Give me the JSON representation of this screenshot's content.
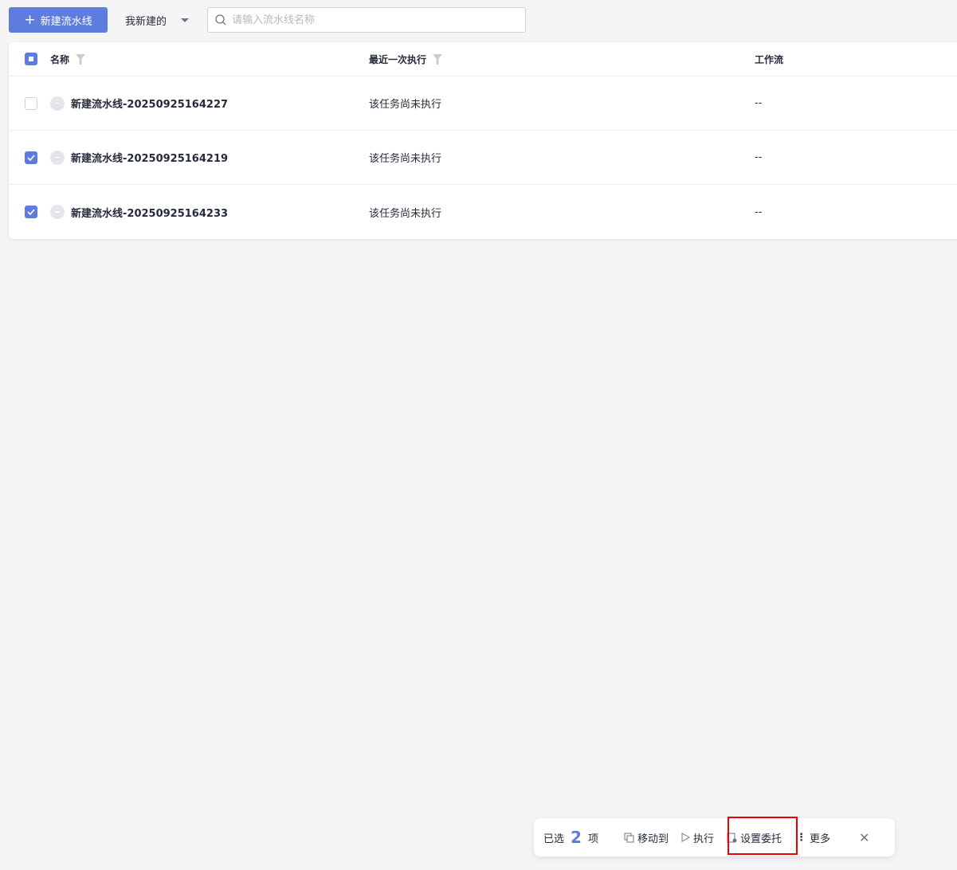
{
  "toolbar": {
    "new_label": "新建流水线",
    "filter_label": "我新建的",
    "search_placeholder": "请输入流水线名称"
  },
  "table": {
    "columns": [
      "名称",
      "最近一次执行",
      "工作流"
    ],
    "rows": [
      {
        "name": "新建流水线-20250925164227",
        "last_run": "该任务尚未执行",
        "workflow": "--",
        "checked": false
      },
      {
        "name": "新建流水线-20250925164219",
        "last_run": "该任务尚未执行",
        "workflow": "--",
        "checked": true
      },
      {
        "name": "新建流水线-20250925164233",
        "last_run": "该任务尚未执行",
        "workflow": "--",
        "checked": true
      }
    ]
  },
  "batch": {
    "prefix": "已选",
    "count": "2",
    "suffix": "项",
    "move": "移动到",
    "run": "执行",
    "delegate": "设置委托",
    "more": "更多"
  },
  "colors": {
    "accent": "#5e7ce0",
    "highlight": "#e00000"
  }
}
